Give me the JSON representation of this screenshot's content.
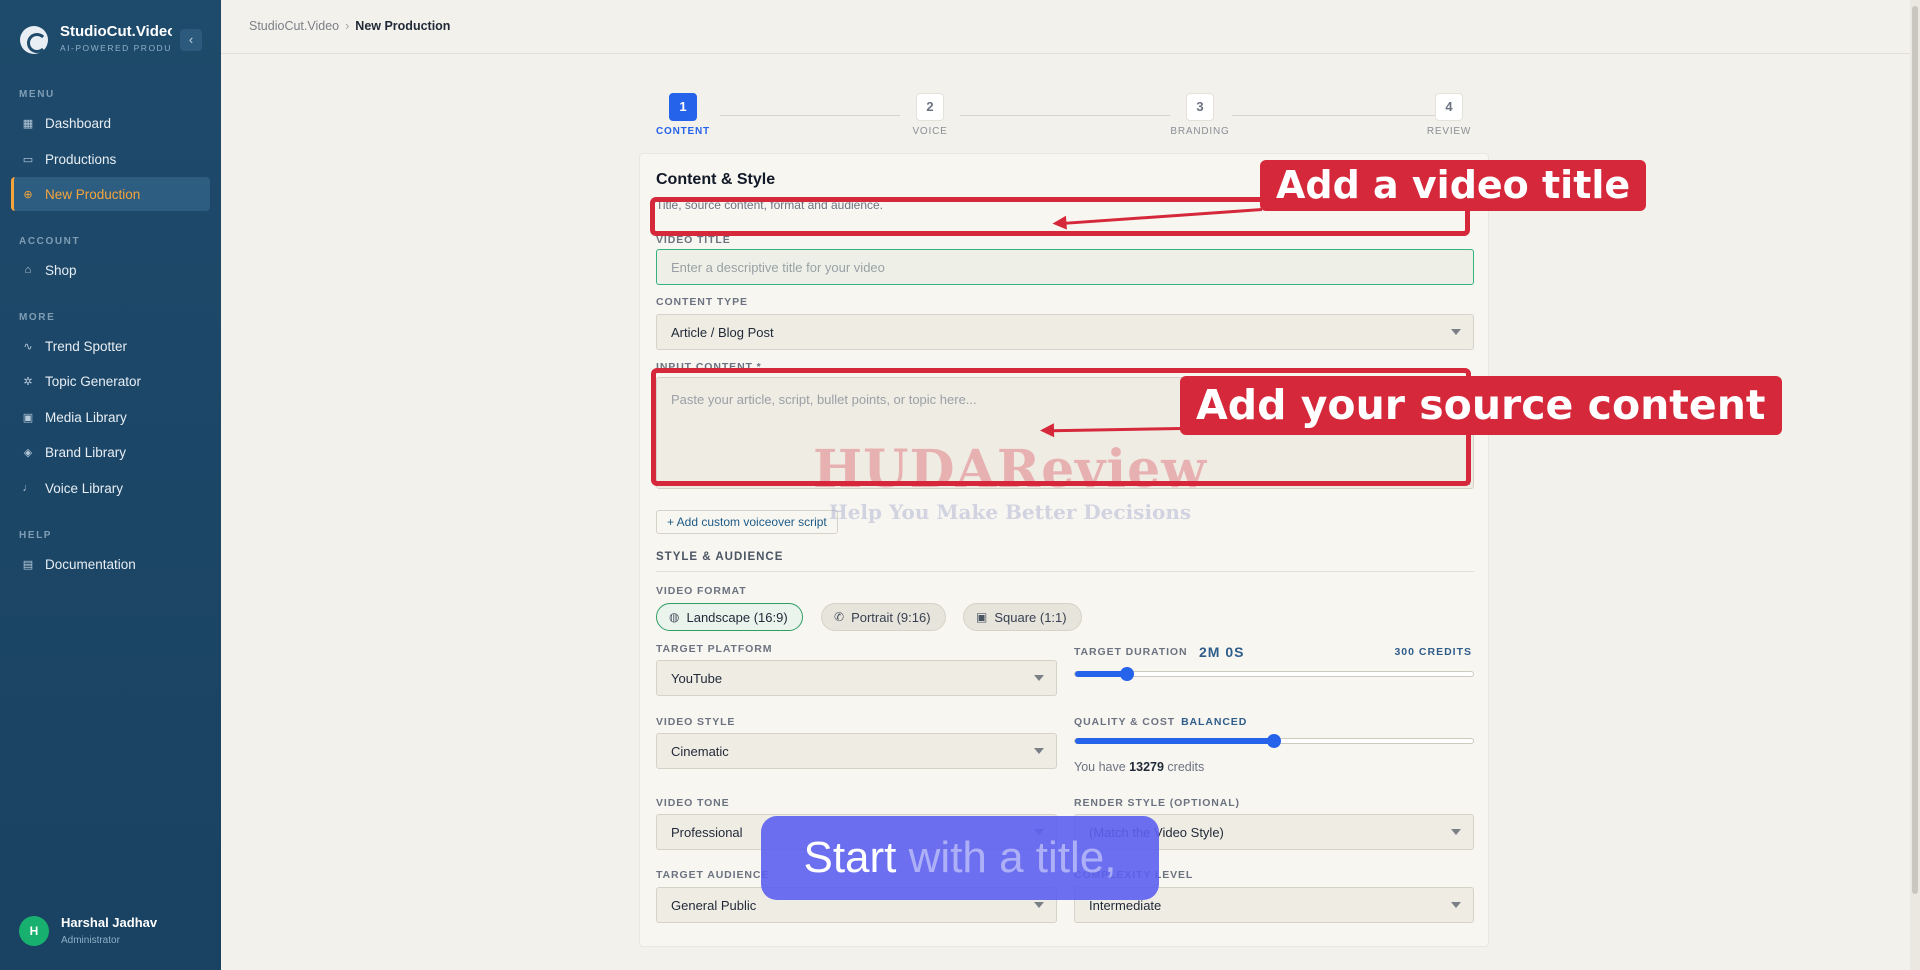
{
  "brand": {
    "name": "StudioCut.Video",
    "tagline": "AI-POWERED PRODUCTION"
  },
  "sidebar": {
    "sections": [
      {
        "title": "MENU",
        "items": [
          {
            "label": "Dashboard",
            "icon": "grid-icon"
          },
          {
            "label": "Productions",
            "icon": "folder-icon"
          },
          {
            "label": "New Production",
            "icon": "plus-circle-icon",
            "active": true
          }
        ]
      },
      {
        "title": "ACCOUNT",
        "items": [
          {
            "label": "Shop",
            "icon": "bag-icon"
          }
        ]
      },
      {
        "title": "MORE",
        "items": [
          {
            "label": "Trend Spotter",
            "icon": "pulse-icon"
          },
          {
            "label": "Topic Generator",
            "icon": "sparkle-icon"
          },
          {
            "label": "Media Library",
            "icon": "image-icon"
          },
          {
            "label": "Brand Library",
            "icon": "tag-icon"
          },
          {
            "label": "Voice Library",
            "icon": "mic-icon"
          }
        ]
      },
      {
        "title": "HELP",
        "items": [
          {
            "label": "Documentation",
            "icon": "book-icon"
          }
        ]
      }
    ]
  },
  "user": {
    "initial": "H",
    "name": "Harshal Jadhav",
    "role": "Administrator"
  },
  "breadcrumb": {
    "root": "StudioCut.Video",
    "current": "New Production"
  },
  "stepper": [
    {
      "num": "1",
      "label": "CONTENT",
      "active": true
    },
    {
      "num": "2",
      "label": "VOICE"
    },
    {
      "num": "3",
      "label": "BRANDING"
    },
    {
      "num": "4",
      "label": "REVIEW"
    }
  ],
  "form": {
    "title": "Content & Style",
    "subtitle": "Title, source content, format and audience.",
    "video_title": {
      "label": "VIDEO TITLE",
      "placeholder": "Enter a descriptive title for your video",
      "value": ""
    },
    "content_type": {
      "label": "CONTENT TYPE",
      "value": "Article / Blog Post"
    },
    "input_content": {
      "label": "INPUT CONTENT *",
      "placeholder": "Paste your article, script, bullet points, or topic here..."
    },
    "custom_script_button": "+ Add custom voiceover script",
    "style_heading": "STYLE & AUDIENCE",
    "video_format": {
      "label": "VIDEO FORMAT",
      "options": [
        {
          "label": "Landscape (16:9)",
          "icon": "globe-icon",
          "selected": true
        },
        {
          "label": "Portrait (9:16)",
          "icon": "phone-icon"
        },
        {
          "label": "Square (1:1)",
          "icon": "image-icon"
        }
      ]
    },
    "target_platform": {
      "label": "TARGET PLATFORM",
      "value": "YouTube"
    },
    "target_duration": {
      "label": "TARGET DURATION",
      "value": "2M 0S",
      "cost": "300 CREDITS",
      "slider_fraction": 0.13
    },
    "video_style": {
      "label": "VIDEO STYLE",
      "value": "Cinematic"
    },
    "quality_cost": {
      "label": "QUALITY & COST",
      "value": "BALANCED",
      "slider_fraction": 0.5
    },
    "credits": {
      "prefix": "You have",
      "amount": "13279",
      "suffix": "credits"
    },
    "video_tone": {
      "label": "VIDEO TONE",
      "value": "Professional"
    },
    "render_style": {
      "label": "RENDER STYLE (OPTIONAL)",
      "value": "(Match the Video Style)"
    },
    "target_audience": {
      "label": "TARGET AUDIENCE",
      "value": "General Public"
    },
    "complexity": {
      "label": "COMPLEXITY LEVEL",
      "value": "Intermediate"
    }
  },
  "annotations": {
    "title_callout": "Add a video title",
    "content_callout": "Add your source content",
    "caption_main": "Start",
    "caption_rest": "with a title,",
    "watermark": "HUDAReview",
    "watermark_sub": "Help You Make Better Decisions"
  },
  "colors": {
    "sidebar": "#1e4a6b",
    "accent_orange": "#f5a53b",
    "primary_blue": "#2563eb",
    "annotation_red": "#d6283b",
    "caption_purple": "#5c60f0"
  }
}
